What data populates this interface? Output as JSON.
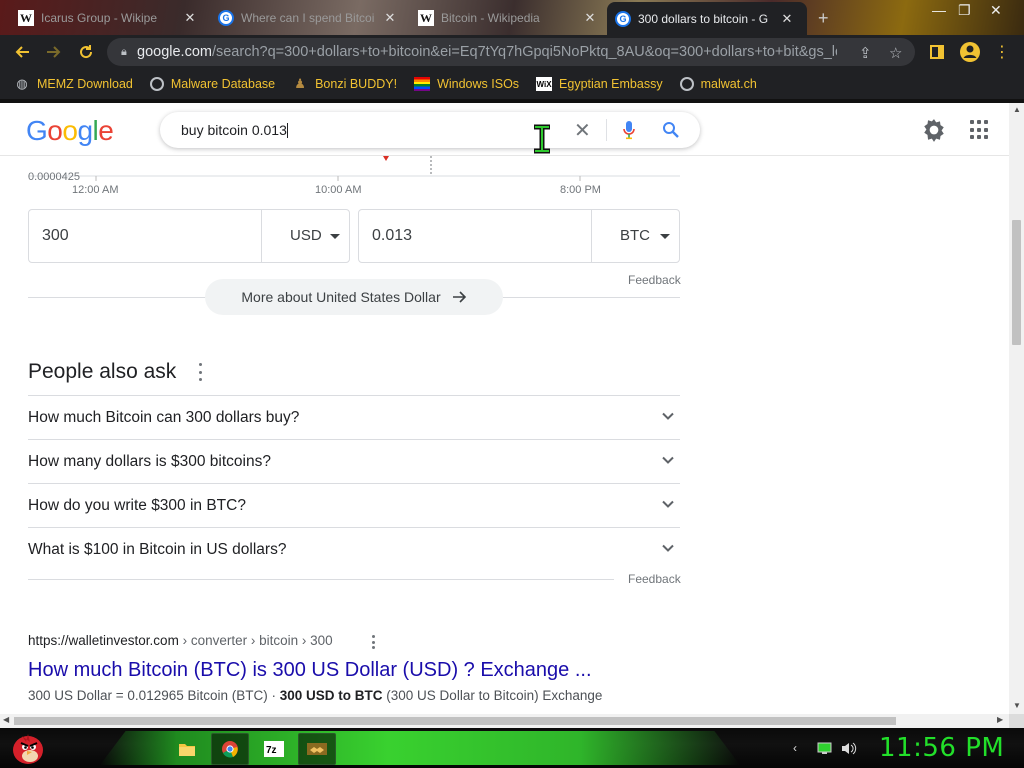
{
  "browser": {
    "tabs": [
      {
        "title": "Icarus Group - Wikipe",
        "favicon": "wikipedia-icon",
        "active": false
      },
      {
        "title": "Where can I spend Bitcoi",
        "favicon": "google-icon",
        "active": false
      },
      {
        "title": "Bitcoin - Wikipedia",
        "favicon": "wikipedia-icon",
        "active": false
      },
      {
        "title": "300 dollars to bitcoin - G",
        "favicon": "google-icon",
        "active": true
      }
    ],
    "new_tab": "+",
    "address_bar": {
      "host": "google.com",
      "path": "/search?q=300+dollars+to+bitcoin&ei=Eq7tYq7hGpqi5NoPktq_8AU&oq=300+dollars+to+bit&gs_lc..."
    },
    "bookmarks": [
      {
        "label": "MEMZ Download",
        "icon": "memz-icon"
      },
      {
        "label": "Malware Database",
        "icon": "globe-icon"
      },
      {
        "label": "Bonzi BUDDY!",
        "icon": "bonzi-icon"
      },
      {
        "label": "Windows ISOs",
        "icon": "rainbow-flag-icon"
      },
      {
        "label": "Egyptian Embassy",
        "icon": "wix-icon"
      },
      {
        "label": "malwat.ch",
        "icon": "globe-icon"
      }
    ]
  },
  "google": {
    "logo": "Google",
    "query": "buy bitcoin 0.013",
    "chart": {
      "y_label": "0.0000425",
      "x_ticks": [
        "12:00 AM",
        "10:00 AM",
        "8:00 PM"
      ]
    },
    "converter": {
      "from_value": "300",
      "from_unit": "USD",
      "to_value": "0.013",
      "to_unit": "BTC",
      "feedback": "Feedback",
      "more_link": "More about United States Dollar"
    },
    "people_also_ask": {
      "title": "People also ask",
      "questions": [
        "How much Bitcoin can 300 dollars buy?",
        "How many dollars is $300 bitcoins?",
        "How do you write $300 in BTC?",
        "What is $100 in Bitcoin in US dollars?"
      ],
      "feedback": "Feedback"
    },
    "result": {
      "site": "https://walletinvestor.com",
      "path": " › converter › bitcoin › 300",
      "title": "How much Bitcoin (BTC) is 300 US Dollar (USD) ? Exchange ...",
      "snippet_plain": "300 US Dollar = 0.012965 Bitcoin (BTC) · ",
      "snippet_bold": "300 USD to BTC",
      "snippet_tail": " (300 US Dollar to Bitcoin) Exchange"
    }
  },
  "taskbar": {
    "clock": "11:56 PM",
    "apps": [
      "file-explorer-icon",
      "chrome-icon",
      "7zip-icon",
      "handshake-icon"
    ]
  },
  "colors": {
    "link": "#1a0dab",
    "accent_yellow": "#f1c232",
    "clock_green": "#22e02a"
  }
}
